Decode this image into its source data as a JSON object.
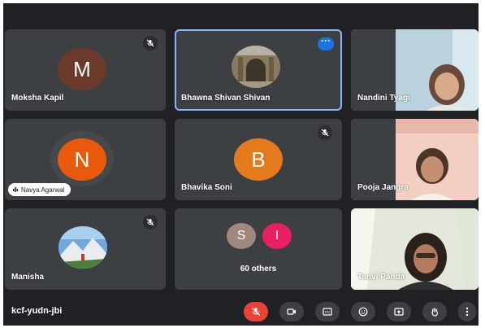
{
  "participants": [
    {
      "name": "Moksha Kapil",
      "initial": "M",
      "avatar_color": "#6b3a2a",
      "muted": true
    },
    {
      "name": "Bhawna Shivan Shivan",
      "avatar": "photo-archway",
      "muted": false,
      "active_tile": true
    },
    {
      "name": "Nandini Tyagi",
      "video": true
    },
    {
      "name": "Navya Agarwal",
      "initial": "N",
      "avatar_color": "#e8590c",
      "speaking": true
    },
    {
      "name": "Bhavika Soni",
      "initial": "B",
      "avatar_color": "#e37b1c",
      "muted": true
    },
    {
      "name": "Pooja Jangra",
      "video": true
    },
    {
      "name": "Manisha",
      "avatar": "photo-mountain",
      "muted": true
    },
    {
      "name": "Tanvi Panda",
      "video": true
    }
  ],
  "others_tile": {
    "label": "60 others",
    "avatars": [
      {
        "initial": "S",
        "color": "#a1887f"
      },
      {
        "initial": "I",
        "color": "#e91e63"
      }
    ]
  },
  "bottom_bar": {
    "meeting_code": "kcf-yudn-jbi",
    "controls": [
      "mic-off-icon",
      "camera-icon",
      "captions-icon",
      "emoji-icon",
      "present-icon",
      "raise-hand-icon",
      "more-options-icon"
    ]
  },
  "colors": {
    "background": "#202124",
    "tile": "#3c4043",
    "accent": "#1a73e8",
    "end_red": "#ea4335"
  }
}
